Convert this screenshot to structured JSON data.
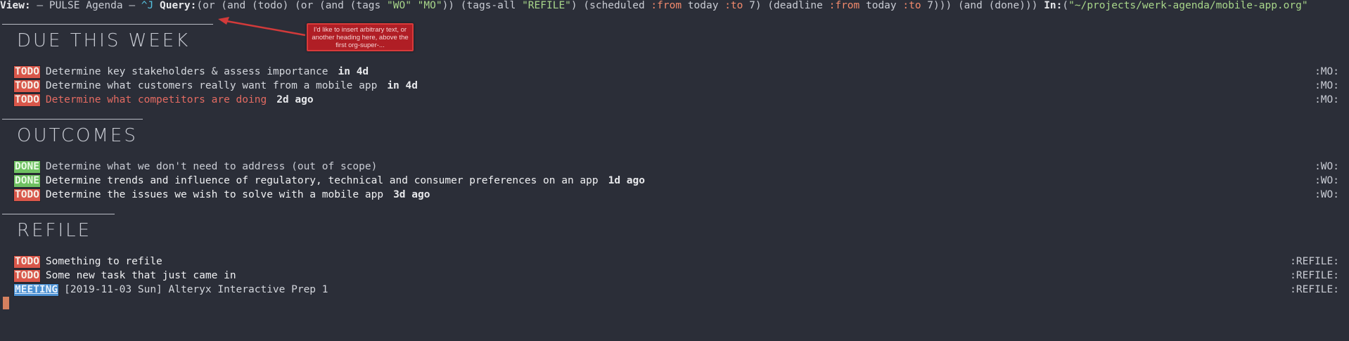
{
  "header": {
    "view_label": "View:",
    "view_title": " — PULSE Agenda — ",
    "hint": "^J",
    "query_label": " Query:",
    "query_parts": [
      {
        "t": "(or (and (todo) (or (and (tags ",
        "c": "plain"
      },
      {
        "t": "\"WO\" \"MO\"",
        "c": "green"
      },
      {
        "t": ")) (tags-all ",
        "c": "plain"
      },
      {
        "t": "\"REFILE\"",
        "c": "green"
      },
      {
        "t": ") (scheduled ",
        "c": "plain"
      },
      {
        "t": ":from",
        "c": "orange"
      },
      {
        "t": " today ",
        "c": "plain"
      },
      {
        "t": ":to",
        "c": "orange"
      },
      {
        "t": " 7) (deadline ",
        "c": "plain"
      },
      {
        "t": ":from",
        "c": "orange"
      },
      {
        "t": " today ",
        "c": "plain"
      },
      {
        "t": ":to",
        "c": "orange"
      },
      {
        "t": " 7))) (and (done)))  ",
        "c": "plain"
      }
    ],
    "in_label": "In:",
    "in_paren": "(",
    "in_path": "\"~/projects/werk-agenda/mobile-app.org\""
  },
  "annotation": {
    "text": "I'd like to insert arbitrary text, or another heading here, above the first org-super-..."
  },
  "sections": [
    {
      "title": "DUE THIS WEEK",
      "items": [
        {
          "keyword": "TODO",
          "title": "Determine key stakeholders & assess importance",
          "due": "in 4d",
          "tag": ":MO:",
          "style": "txt"
        },
        {
          "keyword": "TODO",
          "title": "Determine what customers really want from a mobile app",
          "due": "in 4d",
          "tag": ":MO:",
          "style": "txt"
        },
        {
          "keyword": "TODO",
          "title": "Determine what competitors are doing",
          "due": "2d ago",
          "tag": ":MO:",
          "style": "late"
        }
      ]
    },
    {
      "title": "OUTCOMES",
      "items": [
        {
          "keyword": "DONE",
          "title": "Determine what we don't need to address (out of scope)",
          "due": "",
          "tag": ":WO:",
          "style": "done"
        },
        {
          "keyword": "DONE",
          "title": "Determine trends and influence of regulatory, technical and consumer preferences on an app",
          "due": "1d ago",
          "tag": ":WO:",
          "style": "bright"
        },
        {
          "keyword": "TODO",
          "title": "Determine the issues we wish to solve with a mobile app",
          "due": "3d ago",
          "tag": ":WO:",
          "style": "bright"
        }
      ]
    },
    {
      "title": "REFILE",
      "items": [
        {
          "keyword": "TODO",
          "title": "Something to refile",
          "due": "",
          "tag": ":REFILE:",
          "style": "bright"
        },
        {
          "keyword": "TODO",
          "title": "Some new task that just came in",
          "due": "",
          "tag": ":REFILE:",
          "style": "bright"
        },
        {
          "keyword": "MEETING",
          "title": "[2019-11-03 Sun] Alteryx Interactive Prep 1",
          "due": "",
          "tag": ":REFILE:",
          "style": "txt"
        }
      ]
    }
  ]
}
